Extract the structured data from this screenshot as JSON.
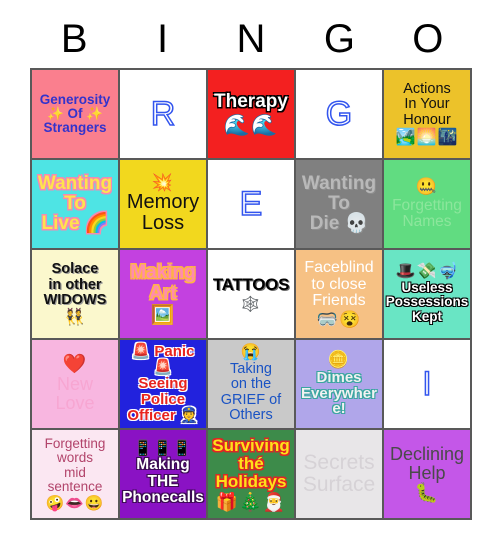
{
  "card": {
    "title": "BINGO",
    "header_letters": [
      "B",
      "I",
      "N",
      "G",
      "O"
    ],
    "grid_border_color": "#595959"
  },
  "cells": [
    {
      "id": "generosity-of-strangers",
      "text": "Generosity\n✨ Of ✨\nStrangers",
      "emoji": "",
      "bg": "#fa7f8e",
      "style": "s-generosity"
    },
    {
      "id": "letter-r",
      "text": "R",
      "emoji": "",
      "bg": "#ffffff",
      "style": "s-letter"
    },
    {
      "id": "therapy",
      "text": "Therapy",
      "emoji": "🌊🌊",
      "bg": "#f32020",
      "style": "s-therapy"
    },
    {
      "id": "letter-g",
      "text": "G",
      "emoji": "",
      "bg": "#ffffff",
      "style": "s-letter"
    },
    {
      "id": "actions-in-your-honour",
      "text": "Actions\nIn Your\nHonour",
      "emoji": "🏞️🌅🌃",
      "bg": "#ecc22a",
      "style": "s-actions"
    },
    {
      "id": "wanting-to-live",
      "text": "Wanting\nTo\nLive 🌈",
      "emoji": "",
      "bg": "#4ee4e4",
      "style": "s-wantlive"
    },
    {
      "id": "memory-loss",
      "text": "Memory\nLoss",
      "emoji": "💥",
      "bg": "#f2d81e",
      "style": "s-memory"
    },
    {
      "id": "letter-e",
      "text": "E",
      "emoji": "",
      "bg": "#ffffff",
      "style": "s-letter"
    },
    {
      "id": "wanting-to-die",
      "text": "Wanting\nTo\nDie 💀",
      "emoji": "",
      "bg": "#808080",
      "style": "s-wantdie"
    },
    {
      "id": "forgetting-names",
      "text": "Forgetting\nNames",
      "emoji": "🤐",
      "bg": "#61dc81",
      "style": "s-forgetnames"
    },
    {
      "id": "solace-in-other-widows",
      "text": "Solace\nin other\nWIDOWS",
      "emoji": "👯",
      "bg": "#fbf8cd",
      "style": "s-solace"
    },
    {
      "id": "making-art",
      "text": "Making\nArt",
      "emoji": "🖼️",
      "bg": "#c341e0",
      "style": "s-makingart"
    },
    {
      "id": "tattoos",
      "text": "TATTOOS",
      "emoji": "🕸️",
      "bg": "#ffffff",
      "style": "s-tattoos"
    },
    {
      "id": "faceblind-to-close-friends",
      "text": "Faceblind\nto close\nFriends",
      "emoji": "🥽😵",
      "bg": "#f6c184",
      "style": "s-faceblind"
    },
    {
      "id": "useless-possessions-kept",
      "text": "Useless\nPossessions\nKept",
      "emoji": "🎩💸🤿",
      "bg": "#69e5c4",
      "style": "s-useless"
    },
    {
      "id": "new-love",
      "text": "New\nLove",
      "emoji": "❤️",
      "bg": "#f8b6e0",
      "style": "s-newlove"
    },
    {
      "id": "panic-seeing-police-officer",
      "text": "🚨 Panic 🚨\nSeeing\nPolice\nOfficer 👮",
      "emoji": "",
      "bg": "#2222dd",
      "style": "s-panic"
    },
    {
      "id": "taking-on-the-grief-of-others",
      "text": "Taking\non the\nGRIEF of\nOthers",
      "emoji": "😭",
      "bg": "#c9c9c9",
      "style": "s-grief"
    },
    {
      "id": "dimes-everywhere",
      "text": "Dimes\nEverywhere!",
      "emoji": "🪙",
      "bg": "#b0a6ea",
      "style": "s-dimes"
    },
    {
      "id": "letter-i",
      "text": "I",
      "emoji": "",
      "bg": "#ffffff",
      "style": "s-letter"
    },
    {
      "id": "forgetting-words-mid-sentence",
      "text": "Forgetting\nwords\nmid\nsentence",
      "emoji": "🤪👄😀",
      "bg": "#fbe7f2",
      "style": "s-forgetwords"
    },
    {
      "id": "making-the-phonecalls",
      "text": "Making\nTHE\nPhonecalls",
      "emoji": "📱📱📱",
      "bg": "#8a12c4",
      "style": "s-phone"
    },
    {
      "id": "surviving-the-holidays",
      "text": "Surviving\nthé\nHolidays",
      "emoji": "🎁🎄🎅",
      "bg": "#3d8b4a",
      "style": "s-holidays"
    },
    {
      "id": "secrets-surface",
      "text": "Secrets\nSurface",
      "emoji": "",
      "bg": "#e8e6e8",
      "style": "s-secrets"
    },
    {
      "id": "declining-help",
      "text": "Declining\nHelp",
      "emoji": "🐛",
      "bg": "#c457e8",
      "style": "s-declining"
    }
  ]
}
